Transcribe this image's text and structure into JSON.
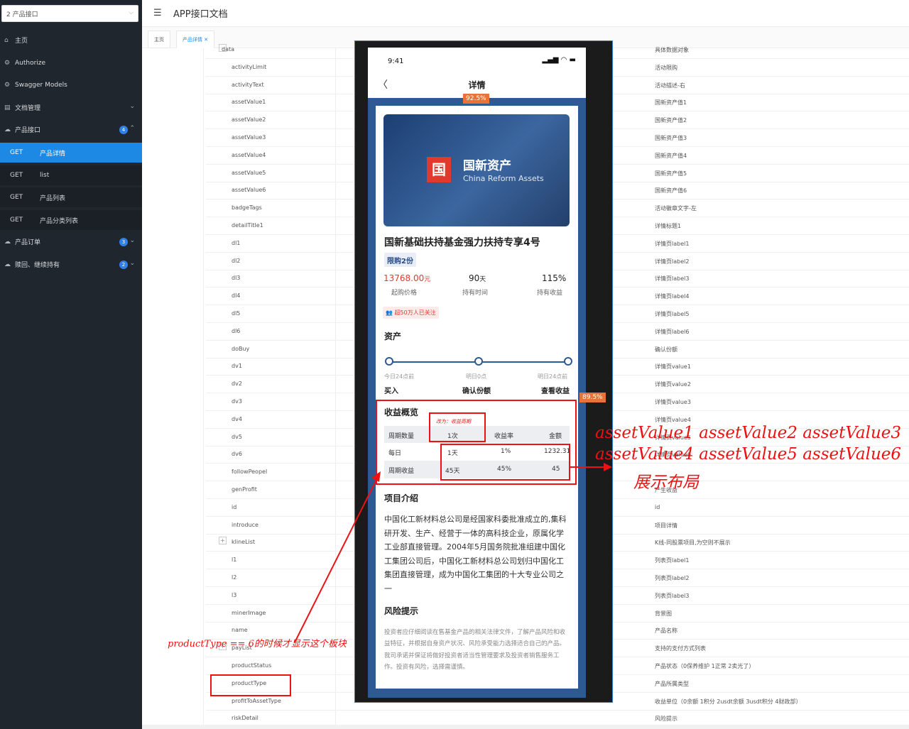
{
  "sidebar": {
    "select_value": "2 产品接口",
    "items": [
      {
        "label": "主页",
        "icon": "home-icon"
      },
      {
        "label": "Authorize",
        "icon": "gear-icon"
      },
      {
        "label": "Swagger Models",
        "icon": "gear-icon"
      },
      {
        "label": "文档管理",
        "icon": "doc-icon"
      },
      {
        "label": "产品接口",
        "icon": "cloud-icon",
        "badge": "4"
      },
      {
        "label": "产品订单",
        "icon": "cloud-icon",
        "badge": "3"
      },
      {
        "label": "赎回、继续持有",
        "icon": "cloud-icon",
        "badge": "2"
      }
    ],
    "sub_items": [
      {
        "method": "GET",
        "label": "产品详情",
        "active": true
      },
      {
        "method": "GET",
        "label": "list"
      },
      {
        "method": "GET",
        "label": "产品列表"
      },
      {
        "method": "GET",
        "label": "产品分类列表"
      }
    ]
  },
  "header": {
    "title": "APP接口文档"
  },
  "tabs": [
    {
      "label": "主页"
    },
    {
      "label": "产品详情 ✕"
    }
  ],
  "fields": [
    {
      "name": "data",
      "desc": "具体数据对象",
      "expand": "-"
    },
    {
      "name": "activityLimit",
      "desc": "活动限购"
    },
    {
      "name": "activityText",
      "desc": "活动描述-右"
    },
    {
      "name": "assetValue1",
      "desc": "国新资产值1"
    },
    {
      "name": "assetValue2",
      "desc": "国新资产值2"
    },
    {
      "name": "assetValue3",
      "desc": "国新资产值3"
    },
    {
      "name": "assetValue4",
      "desc": "国新资产值4"
    },
    {
      "name": "assetValue5",
      "desc": "国新资产值5"
    },
    {
      "name": "assetValue6",
      "desc": "国新资产值6"
    },
    {
      "name": "badgeTags",
      "desc": "活动徽章文字-左"
    },
    {
      "name": "detailTitle1",
      "desc": "详情标题1"
    },
    {
      "name": "dl1",
      "desc": "详情页label1"
    },
    {
      "name": "dl2",
      "desc": "详情页label2"
    },
    {
      "name": "dl3",
      "desc": "详情页label3"
    },
    {
      "name": "dl4",
      "desc": "详情页label4"
    },
    {
      "name": "dl5",
      "desc": "详情页label5"
    },
    {
      "name": "dl6",
      "desc": "详情页label6"
    },
    {
      "name": "doBuy",
      "desc": "确认份额"
    },
    {
      "name": "dv1",
      "desc": "详情页value1"
    },
    {
      "name": "dv2",
      "desc": "详情页value2"
    },
    {
      "name": "dv3",
      "desc": "详情页value3"
    },
    {
      "name": "dv4",
      "desc": "详情页value4"
    },
    {
      "name": "dv5",
      "desc": "详情页value5"
    },
    {
      "name": "dv6",
      "desc": "详情页value6"
    },
    {
      "name": "followPeopel",
      "desc": ""
    },
    {
      "name": "genProfit",
      "desc": "产生收益"
    },
    {
      "name": "id",
      "desc": "id"
    },
    {
      "name": "introduce",
      "desc": "项目详情"
    },
    {
      "name": "klineList",
      "desc": "K线-同股票项目,为空则不展示",
      "expand": "+"
    },
    {
      "name": "l1",
      "desc": "列表页label1"
    },
    {
      "name": "l2",
      "desc": "列表页label2"
    },
    {
      "name": "l3",
      "desc": "列表页label3"
    },
    {
      "name": "minerImage",
      "desc": "背景图"
    },
    {
      "name": "name",
      "desc": "产品名称"
    },
    {
      "name": "payList",
      "desc": "支持的支付方式列表",
      "expand": "+"
    },
    {
      "name": "productStatus",
      "desc": "产品状态（0保养维护 1正常 2卖光了）"
    },
    {
      "name": "productType",
      "desc": "产品所属类型"
    },
    {
      "name": "profitToAssetType",
      "desc": "收益单位（0余额 1积分 2usdt余额 3usdt积分 4财政部）"
    },
    {
      "name": "riskDetail",
      "desc": "风险提示"
    }
  ],
  "phone": {
    "time": "9:41",
    "signal": "▂▄▆ ◠ ▬",
    "back": "〈",
    "title": "详情",
    "zoom_top": "92.5%",
    "zoom_right": "89.5%",
    "banner": {
      "logo": "国",
      "name_cn": "国新资产",
      "name_en": "China Reform Assets"
    },
    "product_title": "国新基础扶持基金强力扶持专享4号",
    "limit_tag": "限购2份",
    "stats": [
      {
        "value": "13768.00",
        "unit": "元",
        "label": "起购价格"
      },
      {
        "value": "90",
        "unit": "天",
        "label": "持有时间"
      },
      {
        "value": "115%",
        "unit": "",
        "label": "持有收益"
      }
    ],
    "follow": "超50万人已关注",
    "asset_heading": "资产",
    "timeline": [
      {
        "time": "今日24点前",
        "label": "买入"
      },
      {
        "time": "明日0点",
        "label": "确认份额"
      },
      {
        "time": "明日24点前",
        "label": "查看收益"
      }
    ],
    "profit_heading": "收益概览",
    "note": "改为：收益周期",
    "table": {
      "headers": [
        "周期数量",
        "1次",
        "收益率",
        "金额"
      ],
      "rows": [
        [
          "每日",
          "1天",
          "1%",
          "1232.31"
        ],
        [
          "周期收益",
          "45天",
          "45%",
          "45"
        ]
      ]
    },
    "intro_heading": "项目介绍",
    "intro_text": "中国化工新材料总公司是经国家科委批准成立的,集科研开发、生产、经营于一体的高科技企业，原属化学工业部直接管理。2004年5月国务院批准组建中国化工集团公司后，中国化工新材料总公司划归中国化工集团直接管理，成为中国化工集团的十大专业公司之一",
    "risk_heading": "风险提示",
    "risk_text": "投资者应仔细阅读在售基金产品的相关法律文件，了解产品风险和收益特征，并根据自身资产状况、风险承受能力选择适合自己的产品。我司承诺并保证将做好投资者适当性管理要求及投资者销售服务工作。投资有风险，选择需谨慎。"
  },
  "annotations": {
    "assets_line1": "assetValue1  assetValue2   assetValue3",
    "assets_line2": "assetValue4  assetValue5   assetValue6",
    "layout_note": "展示布局",
    "condition": "productType == 6的时候才显示这个板块"
  },
  "colors": {
    "accent": "#1e88e5",
    "sidebar": "#20262e",
    "annotation": "#ee1111",
    "phone_blue": "#2e5a93",
    "price_red": "#e03a2d"
  }
}
